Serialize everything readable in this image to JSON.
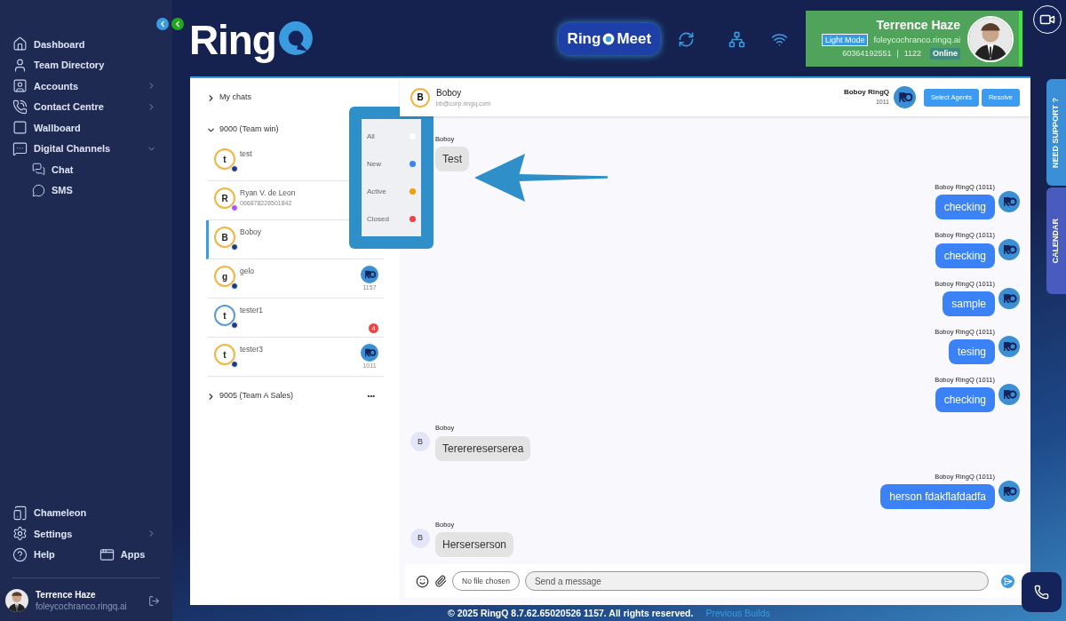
{
  "sidebar": {
    "nav": [
      {
        "label": "Dashboard",
        "has_submenu": false
      },
      {
        "label": "Team Directory",
        "has_submenu": false
      },
      {
        "label": "Accounts",
        "has_submenu": true,
        "expanded": false
      },
      {
        "label": "Contact Centre",
        "has_submenu": true,
        "expanded": false
      },
      {
        "label": "Wallboard",
        "has_submenu": false
      },
      {
        "label": "Digital Channels",
        "has_submenu": true,
        "expanded": true,
        "children": [
          {
            "label": "Chat"
          },
          {
            "label": "SMS"
          }
        ]
      }
    ],
    "bottom_nav": [
      {
        "label": "Chameleon",
        "has_submenu": false
      },
      {
        "label": "Settings",
        "has_submenu": true
      }
    ],
    "help": "Help",
    "apps": "Apps",
    "user": {
      "name": "Terrence Haze",
      "email": "foleycochranco.ringq.ai"
    }
  },
  "header": {
    "logo_text": "Ring",
    "meet_left": "Ring",
    "meet_right": "Meet",
    "profile": {
      "name": "Terrence Haze",
      "mode": "Light Mode",
      "email": "foleycochranco.ringq.ai",
      "phone": "60364192551",
      "separator": "|",
      "extension": "1122",
      "status": "Online"
    }
  },
  "chat_list": {
    "groups": [
      {
        "label": "My chats",
        "expanded": false
      },
      {
        "label": "9000 (Team win)",
        "expanded": true,
        "chats": [
          {
            "initial": "t",
            "name": "test",
            "color": "#f2b544",
            "kind": "web",
            "selected": false
          },
          {
            "initial": "R",
            "name": "Ryan V. de Leon",
            "subtitle": "066878226501842",
            "color": "#f2b544",
            "kind": "sms",
            "selected": false
          },
          {
            "initial": "B",
            "name": "Boboy",
            "color": "#f2b544",
            "kind": "web",
            "selected": true
          },
          {
            "initial": "g",
            "name": "gelo",
            "color": "#f2b544",
            "kind": "web",
            "selected": false,
            "agent": "1157"
          },
          {
            "initial": "t",
            "name": "tester1",
            "color": "#5b9bd5",
            "kind": "web",
            "selected": false,
            "unread": "4"
          },
          {
            "initial": "t",
            "name": "tester3",
            "color": "#f2b544",
            "kind": "web",
            "selected": false,
            "agent": "1011"
          }
        ]
      },
      {
        "label": "9005 (Team A Sales)",
        "expanded": false,
        "more": "•••"
      }
    ]
  },
  "legend": [
    {
      "label": "All",
      "color": "#ffffff"
    },
    {
      "label": "New",
      "color": "#3b82f6"
    },
    {
      "label": "Active",
      "color": "#f59e0b"
    },
    {
      "label": "Closed",
      "color": "#ef4444"
    }
  ],
  "conversation": {
    "initial": "B",
    "name": "Boboy",
    "email": "bb@corp.ringq.com",
    "agent_name": "Boboy RingQ",
    "agent_ext": "1011",
    "buttons": [
      "Select Agents",
      "Resolve"
    ],
    "messages": [
      {
        "kind": "incoming",
        "sender": "Boboy",
        "text": "Test"
      },
      {
        "kind": "outgoing",
        "sender": "Boboy RingQ (1011)",
        "text": "checking"
      },
      {
        "kind": "outgoing",
        "sender": "Boboy RingQ (1011)",
        "text": "checking"
      },
      {
        "kind": "outgoing",
        "sender": "Boboy RingQ (1011)",
        "text": "sample"
      },
      {
        "kind": "outgoing",
        "sender": "Boboy RingQ (1011)",
        "text": "tesing"
      },
      {
        "kind": "outgoing",
        "sender": "Boboy RingQ (1011)",
        "text": "checking"
      },
      {
        "kind": "incoming",
        "sender": "Boboy",
        "initial": "B",
        "text": "Tererereserserea"
      },
      {
        "kind": "outgoing",
        "sender": "Boboy RingQ (1011)",
        "text": "herson fdakflafdadfa"
      },
      {
        "kind": "incoming",
        "sender": "Boboy",
        "initial": "B",
        "text": "Herserserson"
      }
    ],
    "file_button": "No file chosen",
    "message_placeholder": "Send a message"
  },
  "side_tabs": [
    "NEED SUPPORT ?",
    "CALENDAR"
  ],
  "footer": {
    "copyright": "© 2025 RingQ 8.7.62.65020526 1157. All rights reserved.",
    "link": "Previous Builds"
  }
}
